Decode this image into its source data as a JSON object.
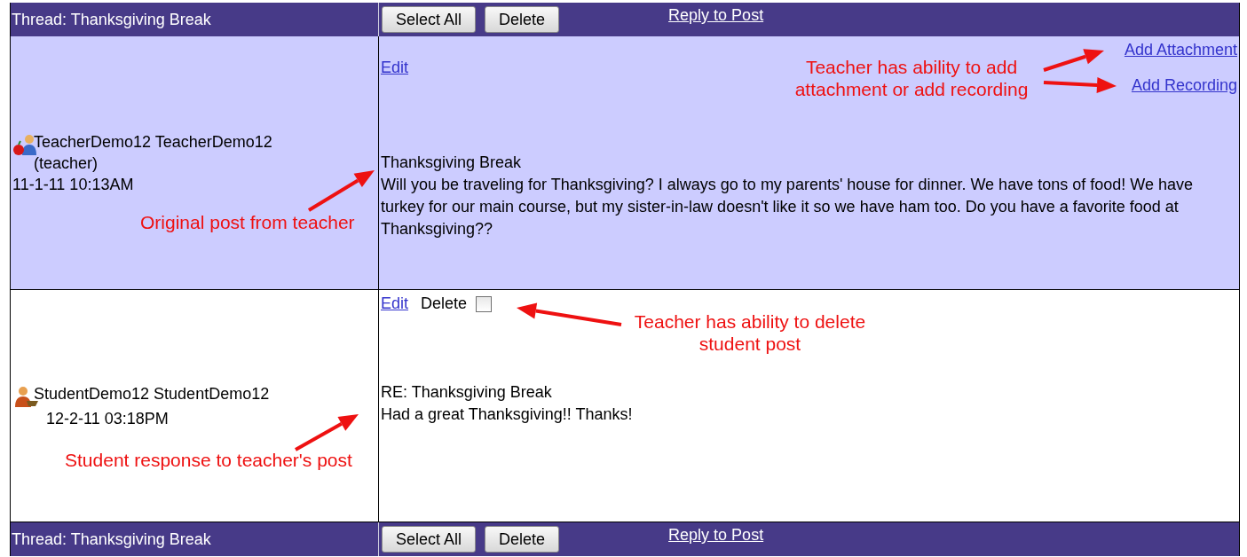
{
  "thread_bars": [
    {
      "title": "Thread: Thanksgiving Break",
      "buttons": [
        "Select All",
        "Delete"
      ],
      "link": "Reply to Post"
    },
    {
      "title": "Thread: Thanksgiving Break",
      "buttons": [
        "Select All",
        "Delete"
      ],
      "link": "Reply to Post"
    }
  ],
  "posts": [
    {
      "kind": "teacher",
      "highlighted": true,
      "author": "TeacherDemo12 TeacherDemo12",
      "role": "(teacher)",
      "date": "11-1-11 10:13AM",
      "actions": [
        {
          "kind": "link",
          "label": "Edit"
        }
      ],
      "side_links": [
        "Add Attachment",
        "Add Recording"
      ],
      "subject": "Thanksgiving Break",
      "body": "Will you be traveling for Thanksgiving? I always go to my parents' house for dinner. We have tons of food! We have turkey for our main course, but my sister-in-law doesn't like it so we have ham too. Do you have a favorite food at Thanksgiving??"
    },
    {
      "kind": "student",
      "highlighted": false,
      "author": "StudentDemo12 StudentDemo12",
      "date": "12-2-11 03:18PM",
      "actions": [
        {
          "kind": "link",
          "label": "Edit"
        },
        {
          "kind": "checkbox",
          "label": "Delete",
          "checked": false
        }
      ],
      "subject": "RE: Thanksgiving Break",
      "body": "Had a great Thanksgiving!! Thanks!"
    }
  ],
  "annotations": [
    "Teacher has ability to add attachment or add recording",
    "Original post from teacher",
    "Teacher has ability to delete student post",
    "Student response to teacher's post"
  ]
}
